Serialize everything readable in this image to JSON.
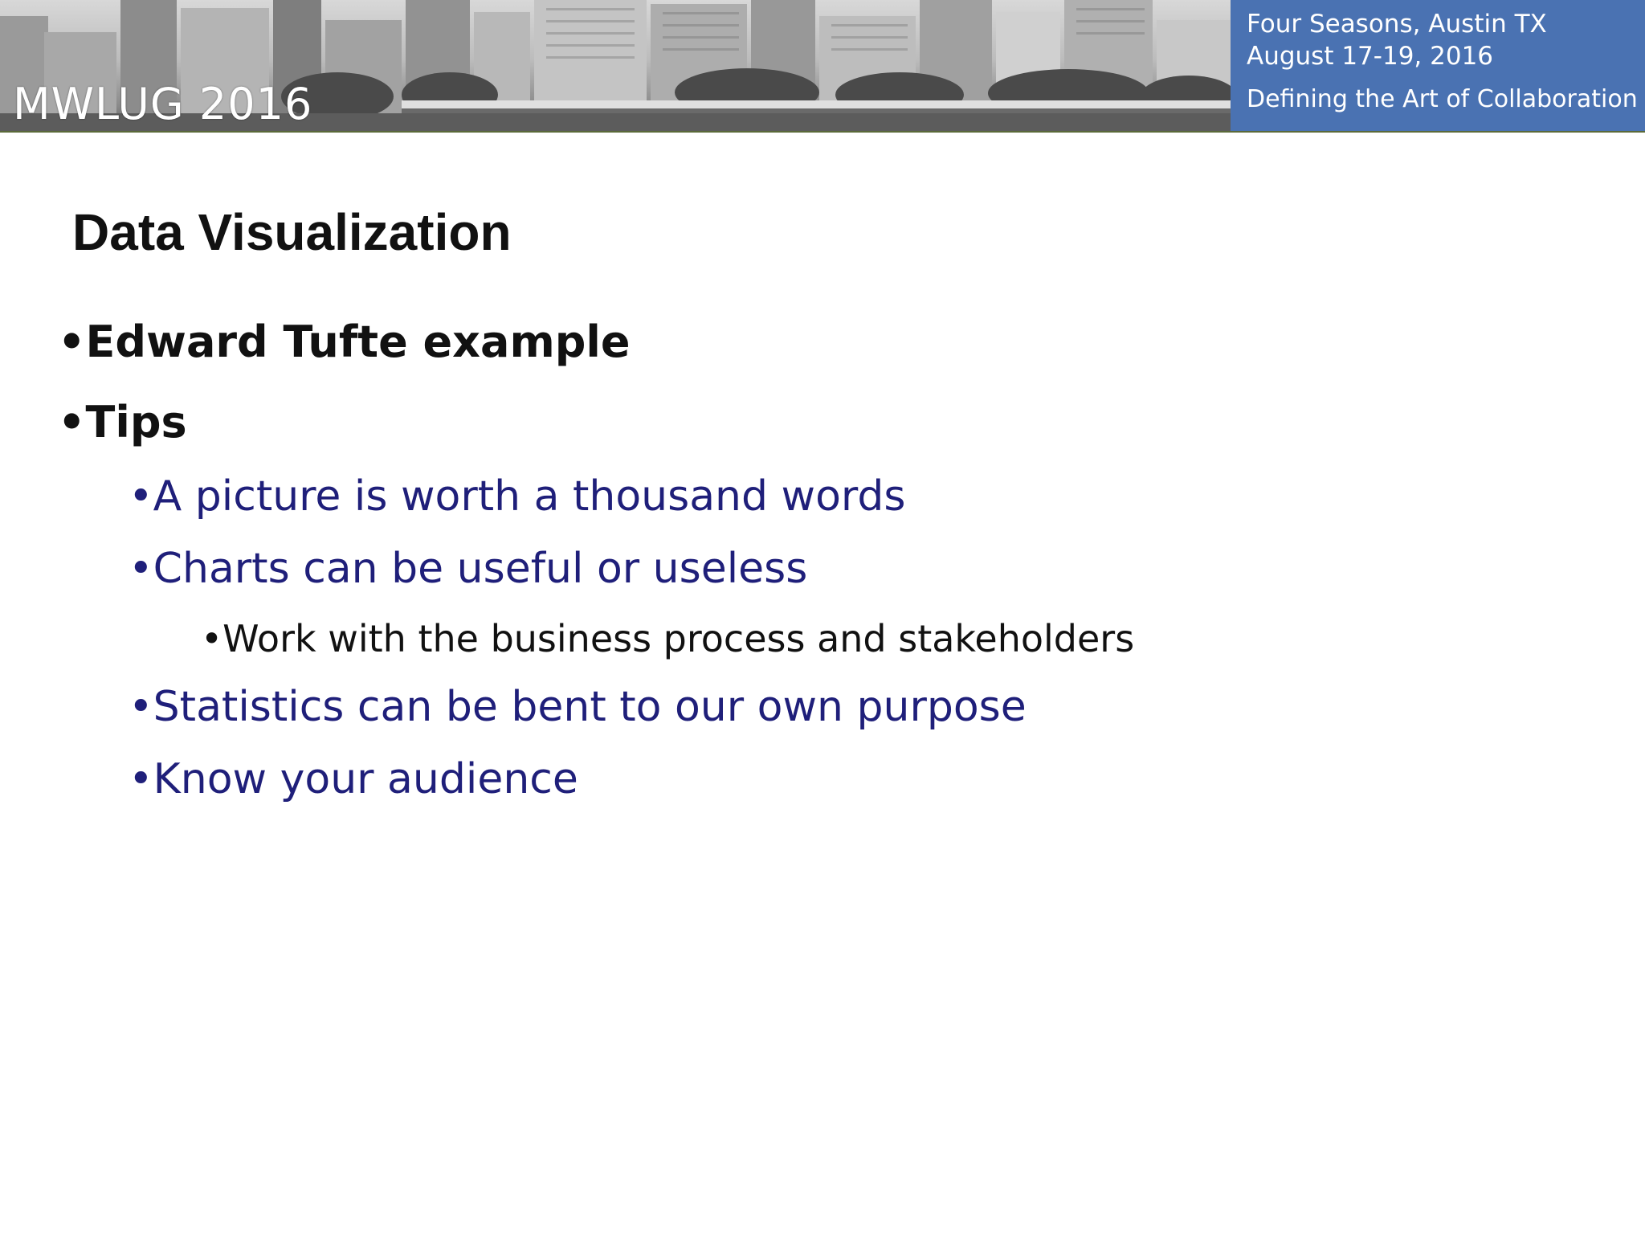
{
  "header": {
    "conference_name": "MWLUG 2016",
    "venue": "Four Seasons, Austin TX",
    "dates": "August 17-19, 2016",
    "tagline": "Defining the Art of Collaboration",
    "panel_color": "#4a72b2"
  },
  "slide": {
    "title": "Data Visualization",
    "bullets": [
      {
        "text": "•Edward Tufte example",
        "level": 1
      },
      {
        "text": "•Tips",
        "level": 1
      },
      {
        "text": "•A picture is worth a thousand words",
        "level": 2
      },
      {
        "text": "•Charts can be useful or useless",
        "level": 2
      },
      {
        "text": "•Work with the business process and stakeholders",
        "level": 3
      },
      {
        "text": "•Statistics can be bent to our own purpose",
        "level": 2
      },
      {
        "text": "•Know your audience",
        "level": 2
      }
    ],
    "accent_text_color": "#1f1f7a"
  }
}
